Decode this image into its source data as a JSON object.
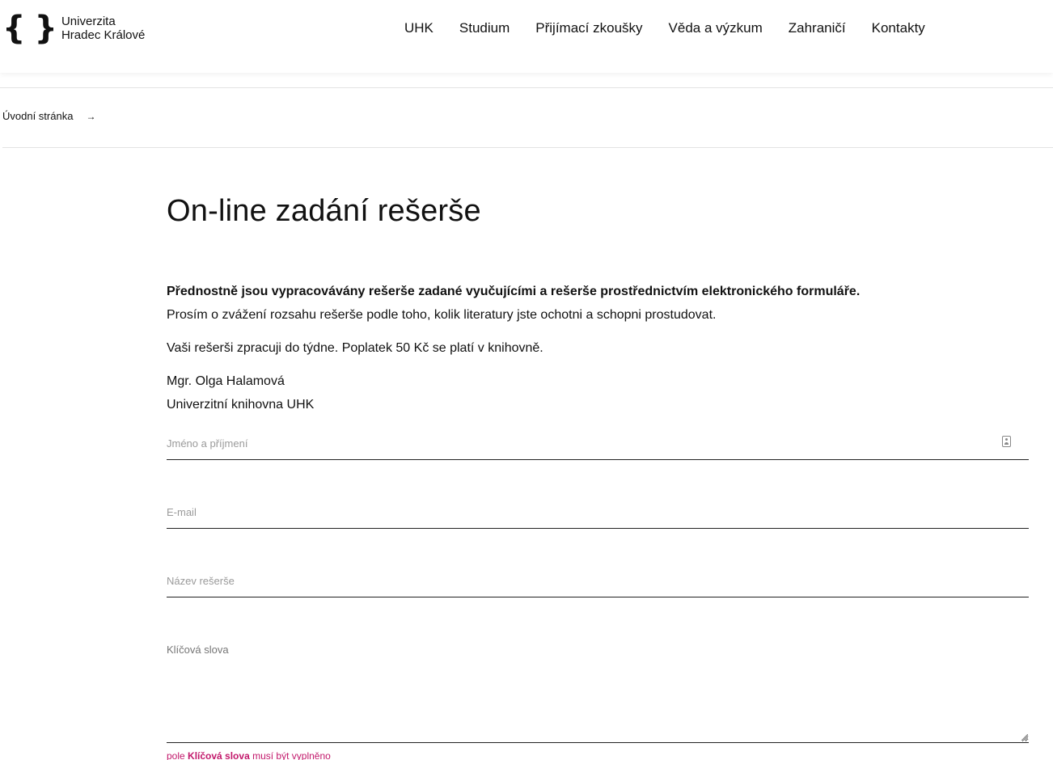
{
  "header": {
    "logo": {
      "line1": "Univerzita",
      "line2": "Hradec Králové"
    },
    "nav": [
      "UHK",
      "Studium",
      "Přijímací zkoušky",
      "Věda a výzkum",
      "Zahraničí",
      "Kontakty"
    ]
  },
  "breadcrumb": {
    "home": "Úvodní stránka",
    "arrow": "→"
  },
  "main": {
    "title": "On-line zadání rešerše",
    "intro_bold": "Přednostně jsou vypracovávány rešerše zadané vyučujícími a rešerše prostřednictvím elektronického formuláře.",
    "intro_line2": "Prosím o zvážení rozsahu rešerše podle toho, kolik literatury jste ochotni a schopni prostudovat.",
    "intro_line3": "Vaši rešerši zpracuji do týdne. Poplatek 50 Kč se platí v knihovně.",
    "contact_name": "Mgr. Olga Halamová",
    "contact_org": "Univerzitní knihovna UHK"
  },
  "form": {
    "name_placeholder": "Jméno a příjmení",
    "email_placeholder": "E-mail",
    "title_placeholder": "Název rešerše",
    "keywords_placeholder": "Klíčová slova",
    "error_prefix": "pole",
    "error_field": "Klíčová slova",
    "error_suffix": "musí být vyplněno"
  },
  "colors": {
    "accent_error": "#c2186b",
    "text": "#111111"
  }
}
